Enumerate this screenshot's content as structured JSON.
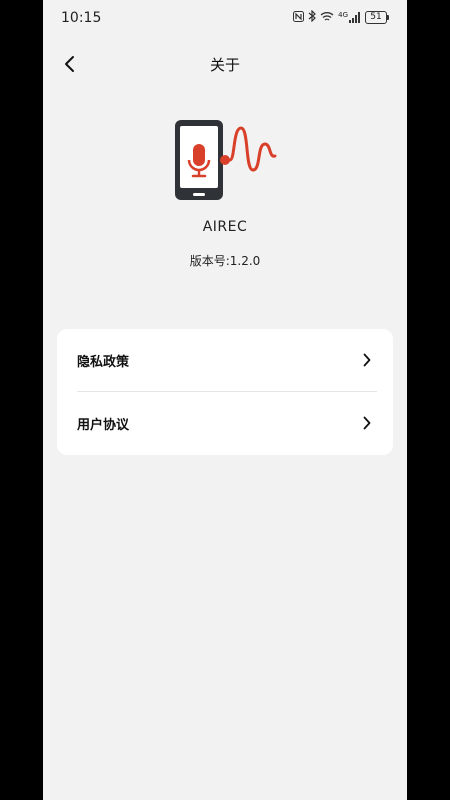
{
  "status_bar": {
    "time": "10:15",
    "icons": [
      "nfc-icon",
      "bluetooth-icon",
      "wifi-icon",
      "signal-icon"
    ],
    "network_label": "4G",
    "battery": "51"
  },
  "header": {
    "title": "关于"
  },
  "app": {
    "name": "AIREC",
    "version": "版本号:1.2.0",
    "logo_colors": {
      "phone": "#2f3338",
      "accent": "#d8402a"
    }
  },
  "menu": {
    "items": [
      {
        "label": "隐私政策"
      },
      {
        "label": "用户协议"
      }
    ]
  }
}
